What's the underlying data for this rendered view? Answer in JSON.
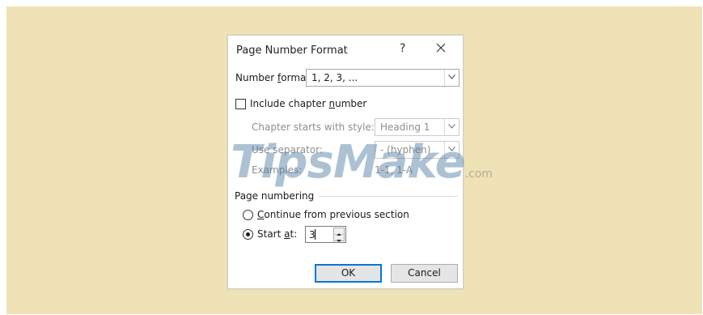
{
  "dialog": {
    "title": "Page Number Format",
    "help_glyph": "?",
    "number_format": {
      "label_pre": "Number ",
      "label_key": "f",
      "label_post": "ormat:",
      "value": "1, 2, 3, ..."
    },
    "include_chapter": {
      "label_pre": "Include chapter ",
      "label_key": "n",
      "label_post": "umber",
      "checked": false
    },
    "chapter_style": {
      "label": "Chapter starts with style:",
      "value": "Heading 1"
    },
    "separator": {
      "label": "Use separator:",
      "value": "-  (hyphen)"
    },
    "examples": {
      "label": "Examples:",
      "value": "1-1, 1-A"
    },
    "page_numbering": {
      "heading": "Page numbering",
      "continue_label_key": "C",
      "continue_label_post": "ontinue from previous section",
      "continue_selected": false,
      "start_label_pre": "Start ",
      "start_label_key": "a",
      "start_label_post": "t:",
      "start_selected": true,
      "start_value": "3"
    },
    "ok_label": "OK",
    "cancel_label": "Cancel"
  },
  "watermark": {
    "text": "TipsMake",
    "suffix": ".com"
  },
  "colors": {
    "backdrop": "#efe2b6",
    "accent": "#0078d7",
    "disabled_text": "#8e8e8e"
  }
}
